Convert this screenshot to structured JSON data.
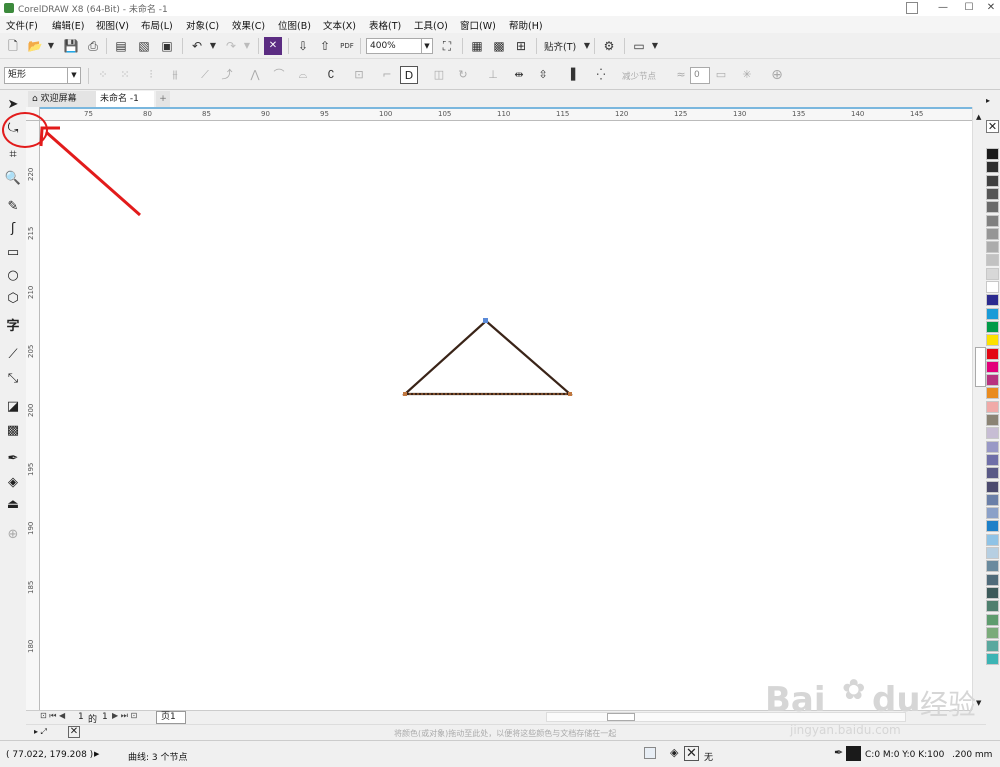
{
  "app": {
    "title": "CorelDRAW X8 (64-Bit) - 未命名 -1",
    "window_buttons": [
      "—",
      "☐",
      "✕"
    ]
  },
  "menu": [
    "文件(F)",
    "编辑(E)",
    "视图(V)",
    "布局(L)",
    "对象(C)",
    "效果(C)",
    "位图(B)",
    "文本(X)",
    "表格(T)",
    "工具(O)",
    "窗口(W)",
    "帮助(H)"
  ],
  "toolbar": {
    "zoom_value": "400%",
    "snap_label": "贴齐(T)",
    "pdf_label": "PDF"
  },
  "property_bar": {
    "shape_select": "矩形",
    "reduce_nodes_label": "减少节点",
    "smooth_value": "0"
  },
  "tabs": {
    "welcome": "欢迎屏幕",
    "document": "未命名 -1",
    "add": "+"
  },
  "hruler_ticks": [
    "75",
    "80",
    "85",
    "90",
    "95",
    "100",
    "105",
    "110",
    "115",
    "120",
    "125",
    "130",
    "135",
    "140",
    "145"
  ],
  "vruler_ticks": [
    "220",
    "215",
    "210",
    "205",
    "200",
    "195",
    "190",
    "185",
    "180"
  ],
  "page_nav": {
    "current": "1",
    "of_label": "的",
    "total": "1",
    "page_tab": "页1"
  },
  "hint_text": "将颜色(或对象)拖动至此处，以便将这些颜色与文档存储在一起",
  "status": {
    "coords": "( 77.022, 179.208 )",
    "info": "曲线: 3 个节点",
    "fill_none": "无",
    "outline_color": "C:0 M:0 Y:0 K:100",
    "outline_width": ".200 mm"
  },
  "watermark": {
    "brand": "Bai",
    "brand2": "du",
    "cn": "经验",
    "url": "jingyan.baidu.com"
  },
  "colors": {
    "accent": "#e21b1b",
    "shape_stroke": "#3a2418",
    "ruler_top": "#7ab7de"
  },
  "palette": [
    "#1a1a1a",
    "#2e2e2e",
    "#404040",
    "#555555",
    "#6a6a6a",
    "#808080",
    "#969696",
    "#acacac",
    "#c2c2c2",
    "#d8d8d8",
    "#ffffff",
    "#2b2a8f",
    "#1a9bd7",
    "#009b48",
    "#fce100",
    "#e30613",
    "#e2007a",
    "#b8337f",
    "#e98b1e",
    "#f0aaa8",
    "#8a8374",
    "#c7bdd4",
    "#9898c6",
    "#6f6fa8",
    "#595986",
    "#4b4a6e",
    "#6a7fa8",
    "#8aa0c8",
    "#1e80c8",
    "#8fc3e6",
    "#b6cfe2",
    "#6a8a9e",
    "#4f6b7a",
    "#3c5a5a",
    "#4e7f6e",
    "#5e9c6e",
    "#7aab7a",
    "#5aa89e",
    "#3cb4b4"
  ]
}
